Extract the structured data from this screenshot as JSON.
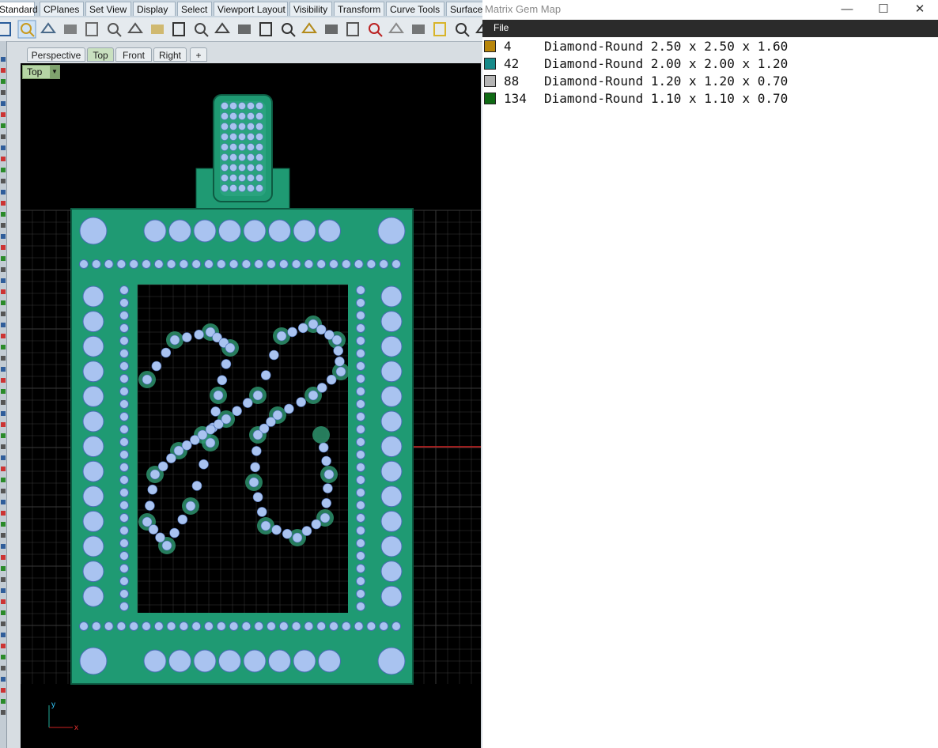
{
  "app": {
    "tabs": [
      "Standard",
      "CPlanes",
      "Set View",
      "Display",
      "Select",
      "Viewport Layout",
      "Visibility",
      "Transform",
      "Curve Tools",
      "Surface"
    ],
    "active_tab": "Standard",
    "toolbar_icons": [
      "new-file-icon",
      "open-folder-icon",
      "save-icon",
      "print-icon",
      "import-icon",
      "cut-icon",
      "copy-icon",
      "paste-icon",
      "undo-icon",
      "pan-hand-icon",
      "rotate-view-icon",
      "zoom-icon",
      "zoom-window-icon",
      "zoom-extents-icon",
      "zoom-selected-icon",
      "rotate-icon",
      "four-viewports-icon",
      "car-icon",
      "render-icon",
      "clock-icon",
      "lightbulb-icon",
      "cursor-icon",
      "redo-icon"
    ],
    "viewport_tabs": [
      "Perspective",
      "Top",
      "Front",
      "Right",
      "+"
    ],
    "active_viewport": "Top",
    "viewport_label": "Top",
    "axis": {
      "x": "x",
      "y": "y"
    }
  },
  "gem_window": {
    "title": "Matrix Gem Map",
    "controls": {
      "minimize": "—",
      "maximize": "☐",
      "close": "✕"
    },
    "menu": [
      "File"
    ],
    "legend": [
      {
        "count": "4",
        "label": "Diamond-Round 2.50 x 2.50 x 1.60",
        "color": "#b8860b"
      },
      {
        "count": "42",
        "label": "Diamond-Round 2.00 x 2.00 x 1.20",
        "color": "#178a8a"
      },
      {
        "count": "88",
        "label": "Diamond-Round 1.20 x 1.20 x 0.70",
        "color": "#b4b4b4"
      },
      {
        "count": "134",
        "label": "Diamond-Round 1.10 x 1.10 x 0.70",
        "color": "#0f6a14"
      }
    ],
    "gem_labels": {
      "large": "2.5",
      "medium": "2",
      "small": "1.2",
      "tiny": "1.1"
    }
  },
  "colors": {
    "metal": "#1f9a73",
    "metal_dark": "#0d5a42",
    "gem_blue": "#a9c3f0",
    "grid": "#3a3a3a"
  }
}
